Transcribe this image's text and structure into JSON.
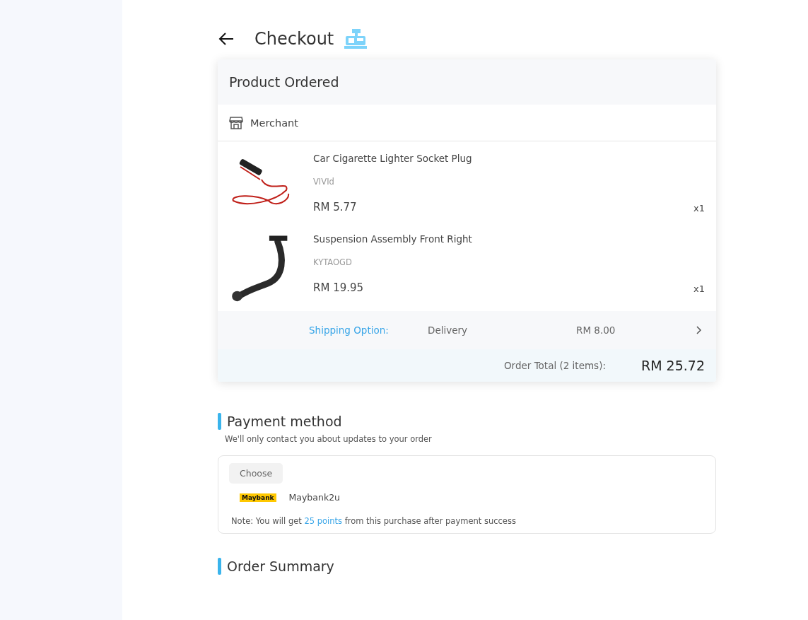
{
  "header": {
    "title": "Checkout"
  },
  "order": {
    "title": "Product Ordered",
    "merchant": "Merchant",
    "items": [
      {
        "name": "Car Cigarette Lighter Socket Plug",
        "brand": "VIVId",
        "price": "RM 5.77",
        "qty": "x1",
        "kind": "cable"
      },
      {
        "name": "Suspension Assembly Front Right",
        "brand": "KYTAOGD",
        "price": "RM 19.95",
        "qty": "x1",
        "kind": "arm"
      }
    ],
    "shipping": {
      "label": "Shipping Option:",
      "method": "Delivery",
      "price": "RM 8.00"
    },
    "total": {
      "label": "Order Total (2 items):",
      "value": "RM 25.72"
    }
  },
  "payment": {
    "title": "Payment method",
    "subtitle": "We'll only contact you about updates to your order",
    "choose": "Choose",
    "bank_logo": "Maybank",
    "bank": "Maybank2u",
    "note_before": "Note: You will get",
    "points": "25 points",
    "note_after": "from this purchase after payment success"
  },
  "summary": {
    "title": "Order Summary"
  }
}
